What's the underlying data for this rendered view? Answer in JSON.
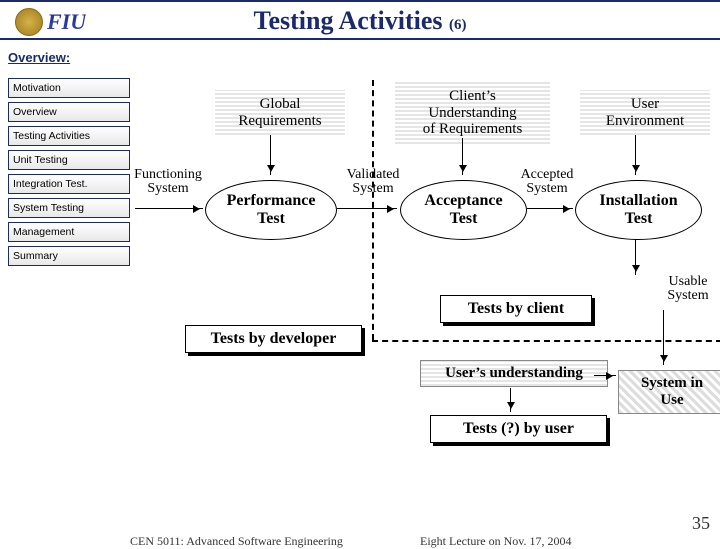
{
  "title": "Testing Activities",
  "title_suffix": "(6)",
  "overview_label": "Overview:",
  "sidebar": {
    "items": [
      {
        "label": "Motivation"
      },
      {
        "label": "Overview"
      },
      {
        "label": "Testing Activities"
      },
      {
        "label": "Unit Testing"
      },
      {
        "label": "Integration Test."
      },
      {
        "label": "System Testing"
      },
      {
        "label": "Management"
      },
      {
        "label": "Summary"
      }
    ]
  },
  "inputs": {
    "global_requirements": "Global\nRequirements",
    "clients_understanding": "Client’s\nUnderstanding\nof Requirements",
    "user_environment": "User\nEnvironment"
  },
  "tests": {
    "performance": "Performance\nTest",
    "acceptance": "Acceptance\nTest",
    "installation": "Installation\nTest"
  },
  "flows": {
    "functioning_system": "Functioning\nSystem",
    "validated_system": "Validated\nSystem",
    "accepted_system": "Accepted\nSystem",
    "usable_system": "Usable\nSystem"
  },
  "groups": {
    "tests_by_developer": "Tests by developer",
    "tests_by_client": "Tests by client",
    "tests_by_user": "Tests (?) by user",
    "users_understanding": "User’s understanding",
    "system_in_use": "System in\nUse"
  },
  "footer": {
    "left": "CEN 5011: Advanced Software Engineering",
    "right": "Eight Lecture on Nov. 17, 2004"
  },
  "slide_number": "35"
}
